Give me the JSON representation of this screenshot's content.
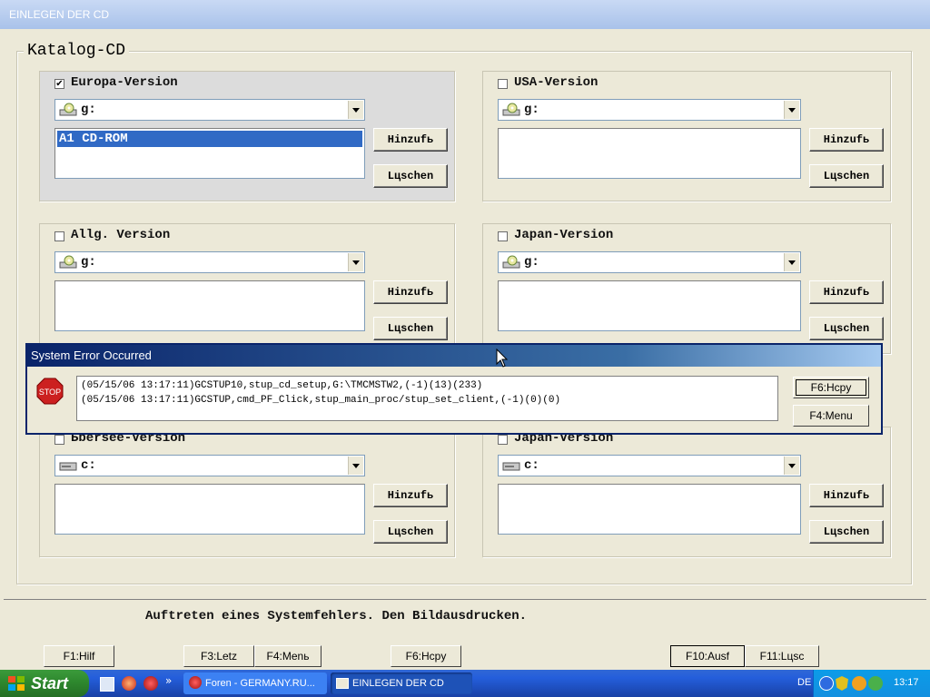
{
  "window": {
    "title": "EINLEGEN DER CD"
  },
  "catalog": {
    "legend": "Katalog-CD",
    "groups": [
      {
        "id": "europa",
        "label": "Europa-Version",
        "checked": true,
        "drive": "g:",
        "items": [
          "A1 CD-ROM"
        ],
        "add": "Hinzufь",
        "del": "Lцschen"
      },
      {
        "id": "usa",
        "label": "USA-Version",
        "checked": false,
        "drive": "g:",
        "items": [],
        "add": "Hinzufь",
        "del": "Lцschen"
      },
      {
        "id": "allg",
        "label": "Allg. Version",
        "checked": false,
        "drive": "g:",
        "items": [],
        "add": "Hinzufь",
        "del": "Lцschen"
      },
      {
        "id": "japan1",
        "label": "Japan-Version",
        "checked": false,
        "drive": "g:",
        "items": [],
        "add": "Hinzufь",
        "del": "Lцschen"
      },
      {
        "id": "uebersee",
        "label": "Ьbersee-Version",
        "checked": false,
        "drive": "c:",
        "items": [],
        "add": "Hinzufь",
        "del": "Lцschen"
      },
      {
        "id": "japan2",
        "label": "Japan-Version",
        "checked": false,
        "drive": "c:",
        "items": [],
        "add": "Hinzufь",
        "del": "Lцschen"
      }
    ]
  },
  "error_dialog": {
    "title": "System Error Occurred",
    "icon_text": "STOP",
    "lines": [
      "(05/15/06 13:17:11)GCSTUP10,stup_cd_setup,G:\\TMCMSTW2,(-1)(13)(233)",
      "(05/15/06 13:17:11)GCSTUP,cmd_PF_Click,stup_main_proc/stup_set_client,(-1)(0)(0)"
    ],
    "btn_copy": "F6:Hcpy",
    "btn_menu": "F4:Menu"
  },
  "status": {
    "message": "Auftreten eines Systemfehlers. Den Bildausdrucken."
  },
  "fkeys": {
    "f1": "F1:Hilf",
    "f3": "F3:Letz",
    "f4": "F4:Menь",
    "f6": "F6:Hcpy",
    "f10": "F10:Ausf",
    "f11": "F11:Lцsc"
  },
  "taskbar": {
    "start": "Start",
    "task1": "Foren - GERMANY.RU...",
    "task2": "EINLEGEN DER CD",
    "lang": "DE",
    "clock": "13:17"
  }
}
